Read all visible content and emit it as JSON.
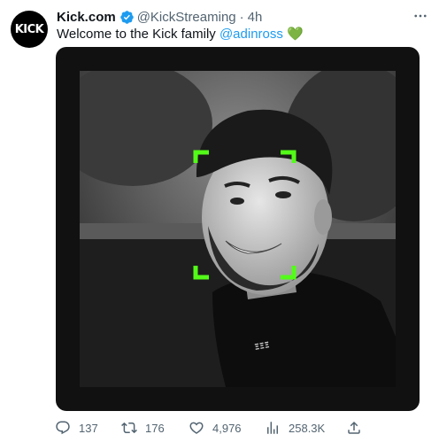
{
  "author": {
    "avatar_text": "KICK",
    "name": "Kick.com",
    "handle": "@KickStreaming",
    "separator": "·",
    "time": "4h"
  },
  "tweet": {
    "text_before": "Welcome to the Kick family ",
    "mention": "@adinross",
    "emoji": "💚"
  },
  "actions": {
    "replies": "137",
    "retweets": "176",
    "likes": "4,976",
    "views": "258.3K"
  },
  "colors": {
    "accent": "#1d9bf0",
    "kick_green": "#53fc18",
    "muted_text": "#536471"
  }
}
